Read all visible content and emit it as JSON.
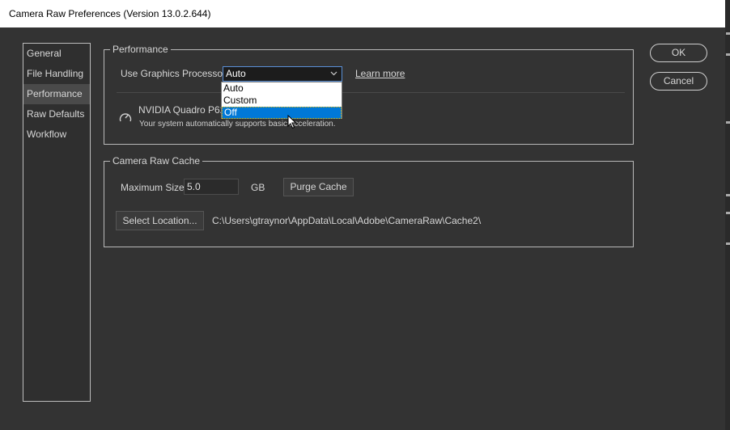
{
  "window": {
    "title": "Camera Raw Preferences  (Version 13.0.2.644)"
  },
  "sidebar": {
    "items": [
      {
        "label": "General"
      },
      {
        "label": "File Handling"
      },
      {
        "label": "Performance",
        "selected": true
      },
      {
        "label": "Raw Defaults"
      },
      {
        "label": "Workflow"
      }
    ]
  },
  "performance": {
    "group_title": "Performance",
    "gpu_label": "Use Graphics Processor:",
    "gpu_value": "Auto",
    "learn_more": "Learn more",
    "gpu_name": "NVIDIA Quadro P620",
    "gpu_note": "Your system automatically supports basic acceleration.",
    "dropdown_options": [
      "Auto",
      "Custom",
      "Off"
    ],
    "dropdown_highlighted": "Off"
  },
  "cache": {
    "group_title": "Camera Raw Cache",
    "max_size_label": "Maximum Size:",
    "max_size_value": "5.0",
    "unit": "GB",
    "purge_label": "Purge Cache",
    "select_location_label": "Select Location...",
    "path": "C:\\Users\\gtraynor\\AppData\\Local\\Adobe\\CameraRaw\\Cache2\\"
  },
  "buttons": {
    "ok": "OK",
    "cancel": "Cancel"
  },
  "icons": {
    "gauge": "gauge-icon",
    "chevron": "chevron-down-icon",
    "cursor": "mouse-pointer-icon"
  },
  "colors": {
    "background": "#333333",
    "select_border": "#5a8fd6",
    "highlight": "#0078d7"
  }
}
